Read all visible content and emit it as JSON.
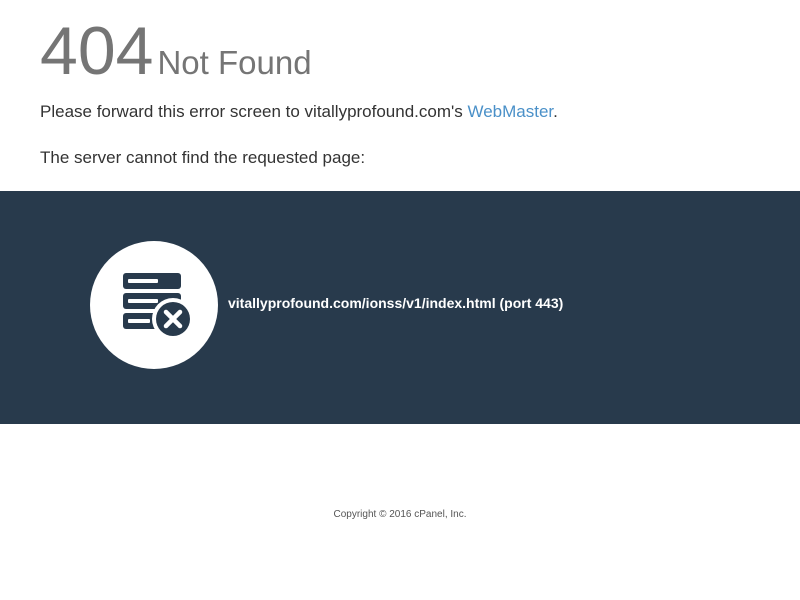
{
  "error": {
    "code": "404",
    "status": "Not Found"
  },
  "message": {
    "forward_prefix": "Please forward this error screen to vitallyprofound.com's ",
    "webmaster_link": "WebMaster",
    "forward_suffix": ".",
    "server_message": "The server cannot find the requested page:"
  },
  "request": {
    "url": "vitallyprofound.com/ionss/v1/index.html",
    "port_label": "(port 443)"
  },
  "icons": {
    "server": "server-error-icon"
  },
  "footer": {
    "copyright": "Copyright © 2016 cPanel, Inc."
  },
  "colors": {
    "band_background": "#283a4c",
    "link": "#4a90c8",
    "heading": "#757575",
    "icon": "#283a4c"
  }
}
